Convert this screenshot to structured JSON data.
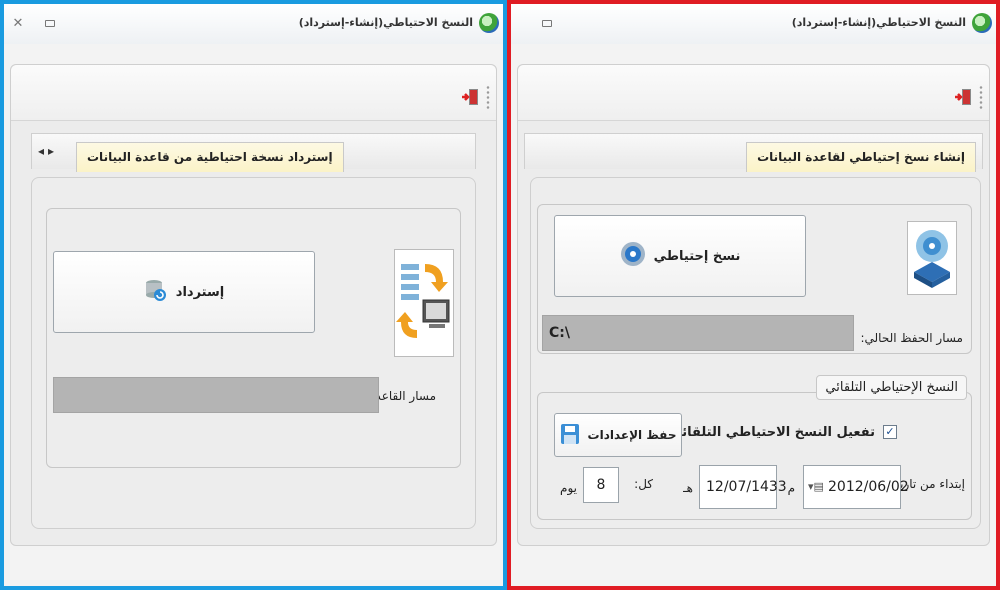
{
  "colors": {
    "left_frame": "#1a9be0",
    "right_frame": "#e01c24"
  },
  "left": {
    "window_title": "النسخ الاحتياطي(إنشاء-إسترداد)",
    "tab_label": "إسترداد نسخة احتياطية من قاعدة البيانات",
    "restore_button": "إسترداد",
    "db_path_label": "مسار القاعدة:",
    "db_path_value": ""
  },
  "right": {
    "window_title": "النسخ الاحتياطي(إنشاء-إسترداد)",
    "tab_label": "إنشاء نسخ إحتياطي لقاعدة البيانات",
    "backup_button": "نسخ إحتياطي",
    "current_path_label": "مسار الحفظ الحالي:",
    "current_path_value": "C:\\",
    "auto_group_title": "النسخ الإحتياطي التلقائي",
    "enable_auto_label": "تفعيل النسخ الاحتياطي التلقائي",
    "enable_auto_checked": true,
    "save_settings_button": "حفظ الإعدادات",
    "start_date_label": "إبتداء من تاريخ:",
    "gregorian_date": "2012/06/02",
    "gregorian_suffix": "م",
    "hijri_date": "12/07/1433",
    "hijri_suffix": "هـ",
    "every_label": "كل:",
    "interval_value": "8",
    "interval_unit": "يوم"
  },
  "icons": {
    "close": "close-icon",
    "minimize": "minimize-icon",
    "app": "app-logo-icon",
    "exit": "exit-door-icon",
    "restore": "database-restore-icon",
    "backup": "backup-disc-icon",
    "save": "floppy-disk-icon",
    "calendar": "calendar-icon"
  }
}
